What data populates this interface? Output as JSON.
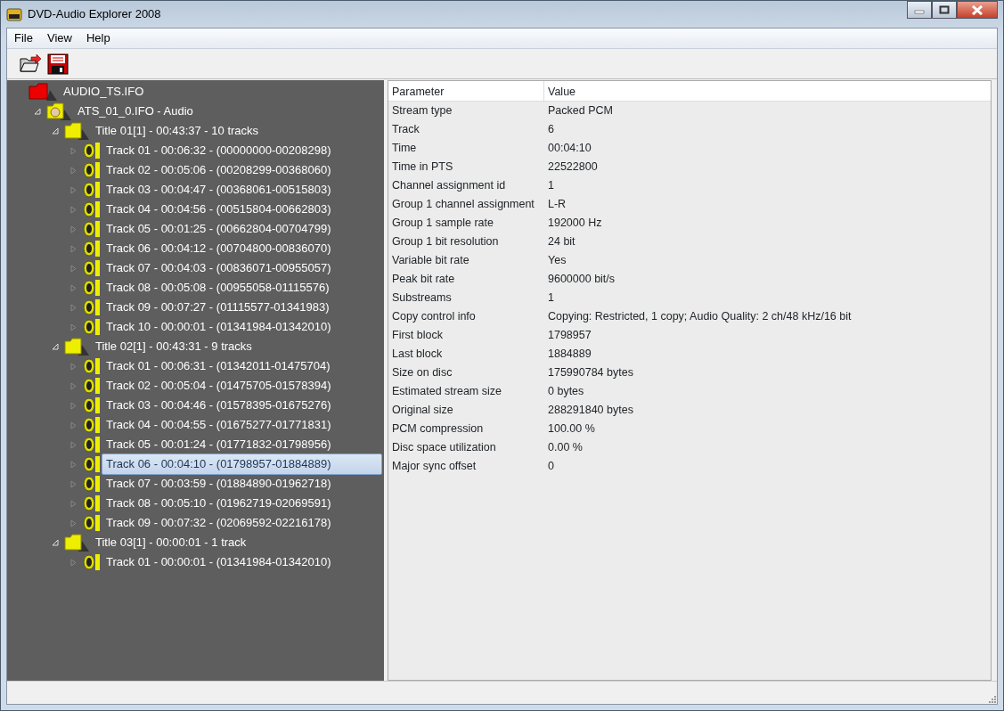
{
  "window": {
    "title": "DVD-Audio Explorer 2008"
  },
  "menu": [
    "File",
    "View",
    "Help"
  ],
  "tree": [
    {
      "kind": "root",
      "label": "AUDIO_TS.IFO",
      "selected": false,
      "children": [
        {
          "kind": "ifo",
          "label": "ATS_01_0.IFO - Audio",
          "selected": false,
          "expanded": true,
          "children": [
            {
              "kind": "title",
              "label": "Title 01[1] - 00:43:37 - 10 tracks",
              "selected": false,
              "expanded": true,
              "children": [
                {
                  "kind": "track",
                  "label": "Track 01 - 00:06:32 - (00000000-00208298)",
                  "selected": false,
                  "expanded": false
                },
                {
                  "kind": "track",
                  "label": "Track 02 - 00:05:06 - (00208299-00368060)",
                  "selected": false,
                  "expanded": false
                },
                {
                  "kind": "track",
                  "label": "Track 03 - 00:04:47 - (00368061-00515803)",
                  "selected": false,
                  "expanded": false
                },
                {
                  "kind": "track",
                  "label": "Track 04 - 00:04:56 - (00515804-00662803)",
                  "selected": false,
                  "expanded": false
                },
                {
                  "kind": "track",
                  "label": "Track 05 - 00:01:25 - (00662804-00704799)",
                  "selected": false,
                  "expanded": false
                },
                {
                  "kind": "track",
                  "label": "Track 06 - 00:04:12 - (00704800-00836070)",
                  "selected": false,
                  "expanded": false
                },
                {
                  "kind": "track",
                  "label": "Track 07 - 00:04:03 - (00836071-00955057)",
                  "selected": false,
                  "expanded": false
                },
                {
                  "kind": "track",
                  "label": "Track 08 - 00:05:08 - (00955058-01115576)",
                  "selected": false,
                  "expanded": false
                },
                {
                  "kind": "track",
                  "label": "Track 09 - 00:07:27 - (01115577-01341983)",
                  "selected": false,
                  "expanded": false
                },
                {
                  "kind": "track",
                  "label": "Track 10 - 00:00:01 - (01341984-01342010)",
                  "selected": false,
                  "expanded": false
                }
              ]
            },
            {
              "kind": "title",
              "label": "Title 02[1] - 00:43:31 - 9 tracks",
              "selected": false,
              "expanded": true,
              "children": [
                {
                  "kind": "track",
                  "label": "Track 01 - 00:06:31 - (01342011-01475704)",
                  "selected": false,
                  "expanded": false
                },
                {
                  "kind": "track",
                  "label": "Track 02 - 00:05:04 - (01475705-01578394)",
                  "selected": false,
                  "expanded": false
                },
                {
                  "kind": "track",
                  "label": "Track 03 - 00:04:46 - (01578395-01675276)",
                  "selected": false,
                  "expanded": false
                },
                {
                  "kind": "track",
                  "label": "Track 04 - 00:04:55 - (01675277-01771831)",
                  "selected": false,
                  "expanded": false
                },
                {
                  "kind": "track",
                  "label": "Track 05 - 00:01:24 - (01771832-01798956)",
                  "selected": false,
                  "expanded": false
                },
                {
                  "kind": "track",
                  "label": "Track 06 - 00:04:10 - (01798957-01884889)",
                  "selected": true,
                  "expanded": false
                },
                {
                  "kind": "track",
                  "label": "Track 07 - 00:03:59 - (01884890-01962718)",
                  "selected": false,
                  "expanded": false
                },
                {
                  "kind": "track",
                  "label": "Track 08 - 00:05:10 - (01962719-02069591)",
                  "selected": false,
                  "expanded": false
                },
                {
                  "kind": "track",
                  "label": "Track 09 - 00:07:32 - (02069592-02216178)",
                  "selected": false,
                  "expanded": false
                }
              ]
            },
            {
              "kind": "title",
              "label": "Title 03[1] - 00:00:01 - 1 track",
              "selected": false,
              "expanded": true,
              "children": [
                {
                  "kind": "track",
                  "label": "Track 01 - 00:00:01 - (01341984-01342010)",
                  "selected": false,
                  "expanded": false
                }
              ]
            }
          ]
        }
      ]
    }
  ],
  "table": {
    "columns": [
      "Parameter",
      "Value"
    ],
    "rows": [
      [
        "Stream type",
        "Packed PCM"
      ],
      [
        "Track",
        "6"
      ],
      [
        "Time",
        "00:04:10"
      ],
      [
        "Time in PTS",
        "22522800"
      ],
      [
        "Channel assignment id",
        "1"
      ],
      [
        "Group 1 channel assignment",
        "L-R"
      ],
      [
        "Group 1 sample rate",
        "192000 Hz"
      ],
      [
        "Group 1 bit resolution",
        "24 bit"
      ],
      [
        "Variable bit rate",
        "Yes"
      ],
      [
        "Peak bit rate",
        "9600000 bit/s"
      ],
      [
        "Substreams",
        "1"
      ],
      [
        "Copy control info",
        "Copying: Restricted, 1 copy; Audio Quality: 2 ch/48 kHz/16 bit"
      ],
      [
        "First block",
        "1798957"
      ],
      [
        "Last block",
        "1884889"
      ],
      [
        "Size on disc",
        "175990784 bytes"
      ],
      [
        "Estimated stream size",
        "0 bytes"
      ],
      [
        "Original size",
        "288291840 bytes"
      ],
      [
        "PCM compression",
        "100.00 %"
      ],
      [
        "Disc space utilization",
        "0.00 %"
      ],
      [
        "Major sync offset",
        "0"
      ]
    ]
  }
}
